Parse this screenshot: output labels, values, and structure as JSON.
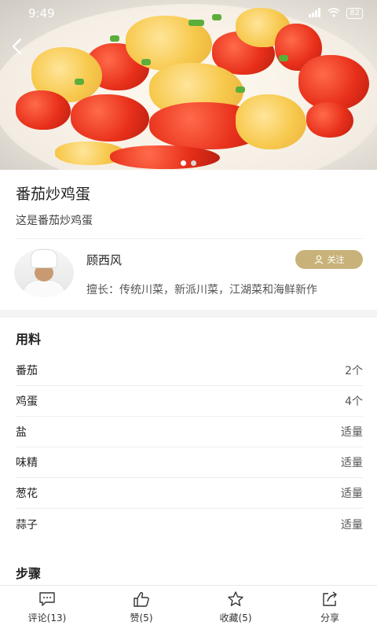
{
  "status_bar": {
    "time": "9:49",
    "battery": "82"
  },
  "hero": {
    "slide_count": 2,
    "active_slide": 1
  },
  "recipe": {
    "title": "番茄炒鸡蛋",
    "description": "这是番茄炒鸡蛋"
  },
  "author": {
    "name": "顾西风",
    "specialty": "擅长：传统川菜，新派川菜，江湖菜和海鲜新作",
    "follow_label": "关注"
  },
  "ingredients": {
    "title": "用料",
    "items": [
      {
        "name": "番茄",
        "amount": "2个"
      },
      {
        "name": "鸡蛋",
        "amount": "4个"
      },
      {
        "name": "盐",
        "amount": "适量"
      },
      {
        "name": "味精",
        "amount": "适量"
      },
      {
        "name": "葱花",
        "amount": "适量"
      },
      {
        "name": "蒜子",
        "amount": "适量"
      }
    ]
  },
  "steps": {
    "title": "步骤"
  },
  "bottom_bar": {
    "comment": "评论(13)",
    "like": "赞(5)",
    "favorite": "收藏(5)",
    "share": "分享"
  },
  "colors": {
    "accent": "#c9b27a",
    "divider": "#eeeeee"
  }
}
